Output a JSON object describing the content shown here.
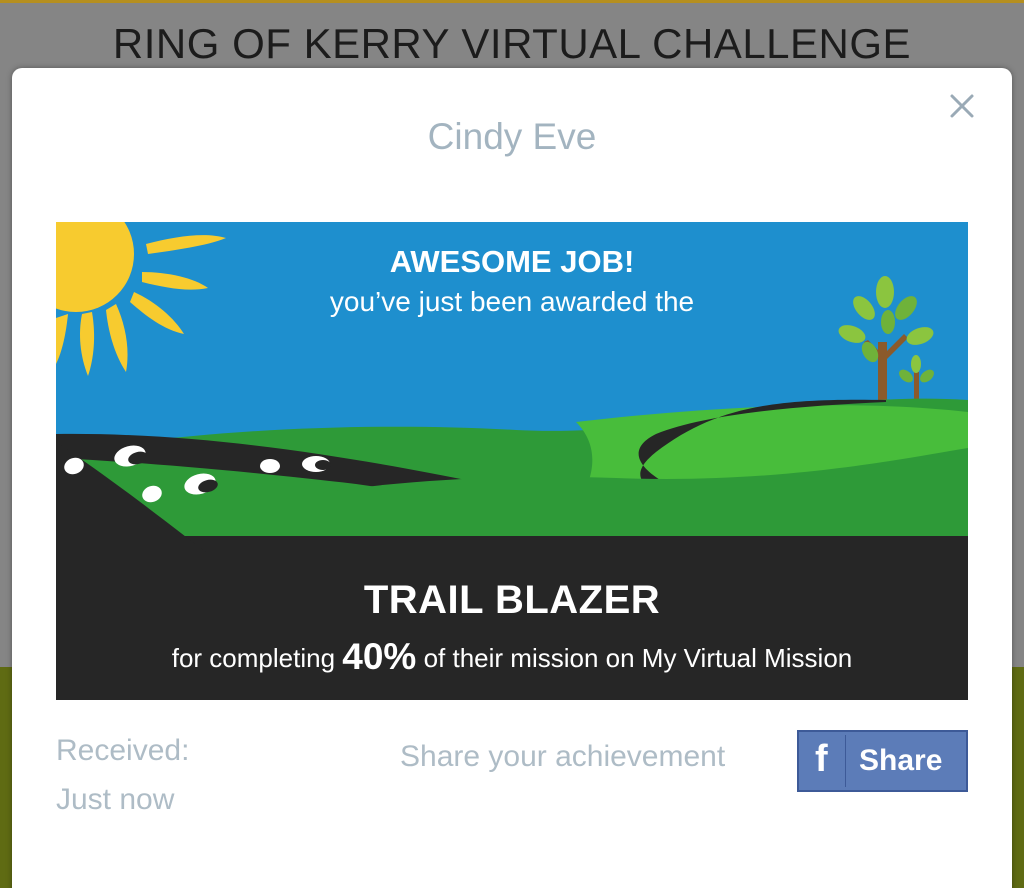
{
  "page": {
    "title": "RING OF KERRY VIRTUAL CHALLENGE"
  },
  "modal": {
    "name": "Cindy Eve",
    "close_icon": "close-icon",
    "banner": {
      "headline": "AWESOME JOB!",
      "subheadline": "you’ve just been awarded the",
      "award_name": "TRAIL BLAZER",
      "description_before": "for completing",
      "percent": "40%",
      "description_after": "of their mission on My Virtual Mission"
    },
    "received_label": "Received:",
    "received_value": "Just now",
    "share_prompt": "Share your achievement",
    "share_button": {
      "icon": "facebook-f",
      "label": "Share"
    }
  },
  "colors": {
    "sky": "#1e8fce",
    "grass_dark": "#2e9a38",
    "grass_light": "#48bd3b",
    "road": "#262626",
    "sun": "#f7cb2f",
    "facebook": "#5c7cb8",
    "muted_text": "#aebcc6"
  }
}
